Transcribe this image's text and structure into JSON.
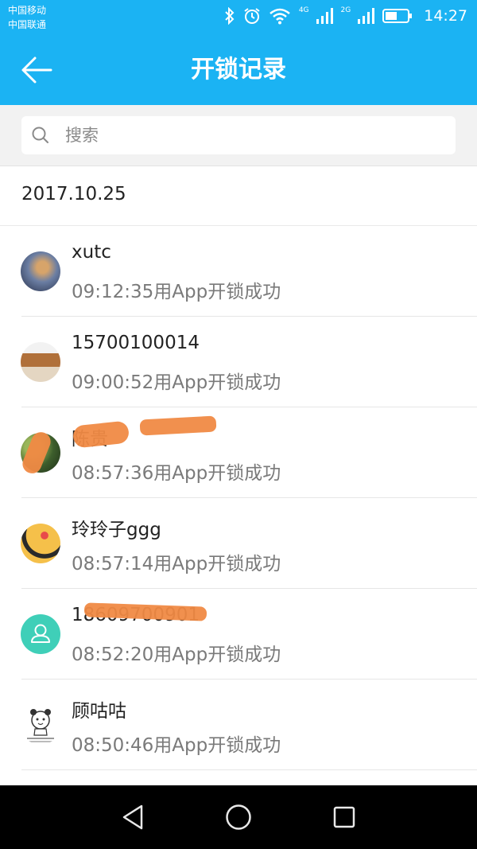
{
  "status_bar": {
    "carrier1": "中国移动",
    "carrier2": "中国联通",
    "net1": "4G",
    "net2": "2G",
    "time": "14:27",
    "icons": [
      "bluetooth-icon",
      "alarm-icon",
      "wifi-icon",
      "signal-icon",
      "signal-icon",
      "battery-icon"
    ]
  },
  "header": {
    "title": "开锁记录",
    "back_icon": "arrow-left-icon",
    "color": "#1bb3f3"
  },
  "search": {
    "placeholder": "搜索",
    "value": "",
    "icon": "search-icon"
  },
  "date": "2017.10.25",
  "records": [
    {
      "name": "xutc",
      "description": "09:12:35用App开锁成功"
    },
    {
      "name": "15700100014",
      "description": "09:00:52用App开锁成功"
    },
    {
      "name": "陈贵",
      "description": "08:57:36用App开锁成功"
    },
    {
      "name": "玲玲子ggg",
      "description": "08:57:14用App开锁成功"
    },
    {
      "name": "18609700901",
      "description": "08:52:20用App开锁成功"
    },
    {
      "name": "顾咕咕",
      "description": "08:50:46用App开锁成功"
    }
  ],
  "nav": {
    "back_icon": "triangle-back-icon",
    "home_icon": "circle-home-icon",
    "recent_icon": "square-recent-icon"
  },
  "colors": {
    "accent": "#1bb3f3",
    "redaction": "#f08a44",
    "default_avatar": "#3fcfb8"
  }
}
